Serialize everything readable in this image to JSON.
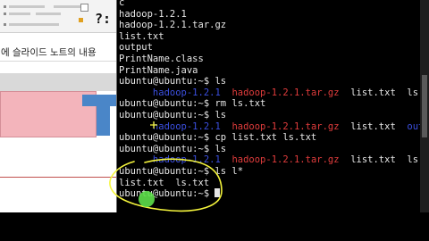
{
  "presentation": {
    "question_glyph": "?:",
    "notes_banner": "에 슬라이드 노트의 내용"
  },
  "terminal": {
    "lines": [
      [
        {
          "t": "c",
          "cls": "c-white"
        }
      ],
      [
        {
          "t": "hadoop-1.2.1",
          "cls": "c-white"
        }
      ],
      [
        {
          "t": "hadoop-1.2.1.tar.gz",
          "cls": "c-white"
        }
      ],
      [
        {
          "t": "list.txt",
          "cls": "c-white"
        }
      ],
      [
        {
          "t": "output",
          "cls": "c-white"
        }
      ],
      [
        {
          "t": "PrintName.class",
          "cls": "c-white"
        }
      ],
      [
        {
          "t": "PrintName.java",
          "cls": "c-white"
        }
      ],
      [
        {
          "t": "ubuntu@ubuntu:~$ ls",
          "cls": "c-white"
        }
      ],
      [
        {
          "t": "      hadoop-1.2.1  ",
          "cls": "c-blue"
        },
        {
          "t": "hadoop-1.2.1.tar.gz",
          "cls": "c-red"
        },
        {
          "t": "  list.txt  ls.txt",
          "cls": "c-white"
        }
      ],
      [
        {
          "t": "ubuntu@ubuntu:~$ rm ls.txt",
          "cls": "c-white"
        }
      ],
      [
        {
          "t": "ubuntu@ubuntu:~$ ls",
          "cls": "c-white"
        }
      ],
      [
        {
          "t": "      hadoop-1.2.1  ",
          "cls": "c-blue"
        },
        {
          "t": "hadoop-1.2.1.tar.gz",
          "cls": "c-red"
        },
        {
          "t": "  list.txt  ",
          "cls": "c-white"
        },
        {
          "t": "output",
          "cls": "c-blue"
        },
        {
          "t": "  P",
          "cls": "c-white"
        }
      ],
      [
        {
          "t": "ubuntu@ubuntu:~$ cp list.txt ls.txt",
          "cls": "c-white"
        }
      ],
      [
        {
          "t": "ubuntu@ubuntu:~$ ls",
          "cls": "c-white"
        }
      ],
      [
        {
          "t": "      hadoop-1.2.1  ",
          "cls": "c-blue"
        },
        {
          "t": "hadoop-1.2.1.tar.gz",
          "cls": "c-red"
        },
        {
          "t": "  list.txt  ls.txt",
          "cls": "c-white"
        }
      ],
      [
        {
          "t": "ubuntu@ubuntu:~$ ls l*",
          "cls": "c-white"
        }
      ],
      [
        {
          "t": "list.txt  ls.txt",
          "cls": "c-white"
        }
      ],
      [
        {
          "t": "ubuntu@ubuntu:~$ ",
          "cls": "c-white"
        }
      ]
    ]
  },
  "colors": {
    "terminal_bg": "#000000",
    "directory": "#3b4fe0",
    "archive": "#e13c3c",
    "highlight": "#f5f53c",
    "pointer": "#5de04a"
  }
}
